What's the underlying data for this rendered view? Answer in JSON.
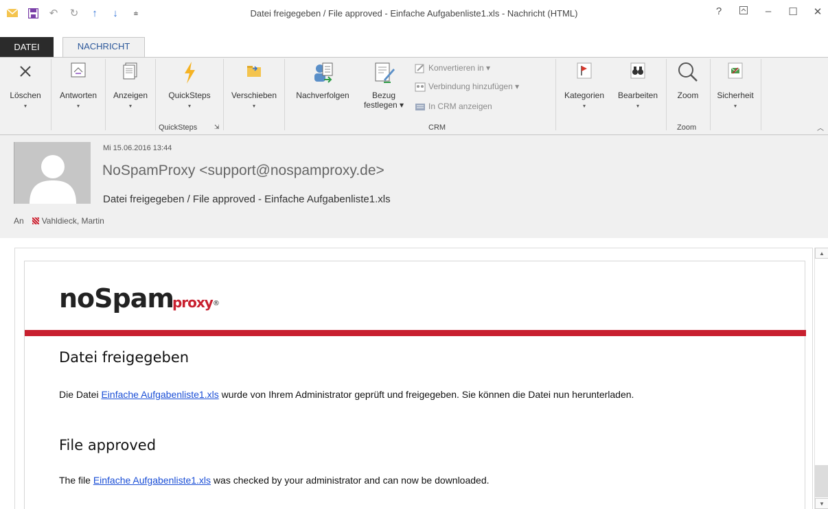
{
  "window": {
    "title": "Datei freigegeben / File approved - Einfache Aufgabenliste1.xls - Nachricht (HTML)",
    "help": "?",
    "ribbon_options_icon": "ribbon-display-icon",
    "minimize": "–",
    "maximize": "☐",
    "close": "✕"
  },
  "qat": {
    "items": [
      "mail-icon",
      "save-icon",
      "undo-icon",
      "redo-icon",
      "up-arrow-icon",
      "down-arrow-icon",
      "customize-icon"
    ]
  },
  "tabs": {
    "file": "DATEI",
    "message": "NACHRICHT"
  },
  "ribbon": {
    "delete": "Löschen",
    "reply": "Antworten",
    "show": "Anzeigen",
    "quicksteps": "QuickSteps",
    "move": "Verschieben",
    "followup": "Nachverfolgen",
    "regarding_line1": "Bezug",
    "regarding_line2": "festlegen",
    "convert": "Konvertieren in",
    "add_connection": "Verbindung hinzufügen",
    "show_in_crm": "In CRM anzeigen",
    "categories": "Kategorien",
    "edit": "Bearbeiten",
    "zoom": "Zoom",
    "security": "Sicherheit",
    "group_quicksteps": "QuickSteps",
    "group_crm": "CRM",
    "group_zoom": "Zoom"
  },
  "message": {
    "date": "Mi 15.06.2016 13:44",
    "sender": "NoSpamProxy <support@nospamproxy.de>",
    "subject": "Datei freigegeben / File approved - Einfache Aufgabenliste1.xls",
    "to_label": "An",
    "to_name": "Vahldieck, Martin"
  },
  "email": {
    "logo_main": "noSpam",
    "logo_sub": "proxy",
    "logo_reg": "®",
    "de_heading": "Datei freigegeben",
    "de_text_before": "Die Datei ",
    "de_link": "Einfache Aufgabenliste1.xls",
    "de_text_after": " wurde von Ihrem Administrator geprüft und freigegeben. Sie können die Datei nun herunterladen.",
    "en_heading": "File approved",
    "en_text_before": "The file ",
    "en_link": "Einfache Aufgabenliste1.xls",
    "en_text_after": " was checked by your administrator and can now be downloaded."
  },
  "colors": {
    "brand_red": "#c8202f",
    "link_blue": "#1a4ed6",
    "tab_blue": "#2b579a"
  }
}
